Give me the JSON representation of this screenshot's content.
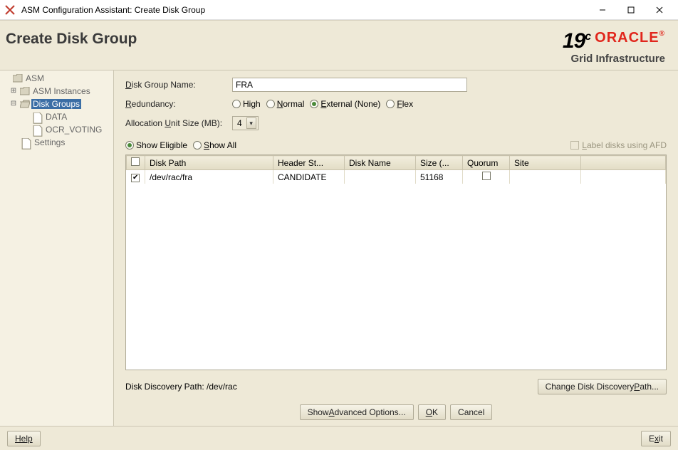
{
  "window": {
    "title": "ASM Configuration Assistant: Create Disk Group"
  },
  "header": {
    "page_title": "Create Disk Group",
    "brand_version": "19",
    "brand_version_suffix": "c",
    "brand_vendor": "ORACLE",
    "brand_reg": "®",
    "brand_sub": "Grid Infrastructure"
  },
  "sidebar": {
    "root": "ASM",
    "instances": "ASM Instances",
    "disk_groups": "Disk Groups",
    "dg_children": [
      "DATA",
      "OCR_VOTING"
    ],
    "settings": "Settings"
  },
  "form": {
    "dg_name_label_pre": "D",
    "dg_name_label_rest": "isk Group Name:",
    "dg_name_value": "FRA",
    "redundancy_label_pre": "R",
    "redundancy_label_rest": "edundancy:",
    "redundancy_options": {
      "high": "High",
      "normal_pre": "N",
      "normal_rest": "ormal",
      "external_pre": "E",
      "external_rest": "xternal (None)",
      "flex_pre": "F",
      "flex_rest": "lex"
    },
    "alloc_label_pre": "Allocation ",
    "alloc_label_u": "U",
    "alloc_label_rest": "nit Size (MB):",
    "alloc_value": "4",
    "show_eligible": "Show Eligible",
    "show_all_pre": "S",
    "show_all_rest": "how All",
    "afd_label_pre": "L",
    "afd_label_rest": "abel disks using AFD"
  },
  "table": {
    "headers": {
      "disk_path": "Disk Path",
      "header_status": "Header St...",
      "disk_name": "Disk Name",
      "size": "Size (...",
      "quorum": "Quorum",
      "site": "Site"
    },
    "rows": [
      {
        "checked": true,
        "disk_path": "/dev/rac/fra",
        "header_status": "CANDIDATE",
        "disk_name": "",
        "size": "51168",
        "quorum": false,
        "site": ""
      }
    ]
  },
  "discovery": {
    "label": "Disk Discovery Path: /dev/rac",
    "change_btn_pre": "Change Disk Discovery ",
    "change_btn_u": "P",
    "change_btn_rest": "ath..."
  },
  "buttons": {
    "advanced_pre": "Show ",
    "advanced_u": "A",
    "advanced_rest": "dvanced Options...",
    "ok_u": "O",
    "ok_rest": "K",
    "cancel": "Cancel",
    "help": "Help",
    "exit_pre": "E",
    "exit_u": "x",
    "exit_rest": "it"
  }
}
